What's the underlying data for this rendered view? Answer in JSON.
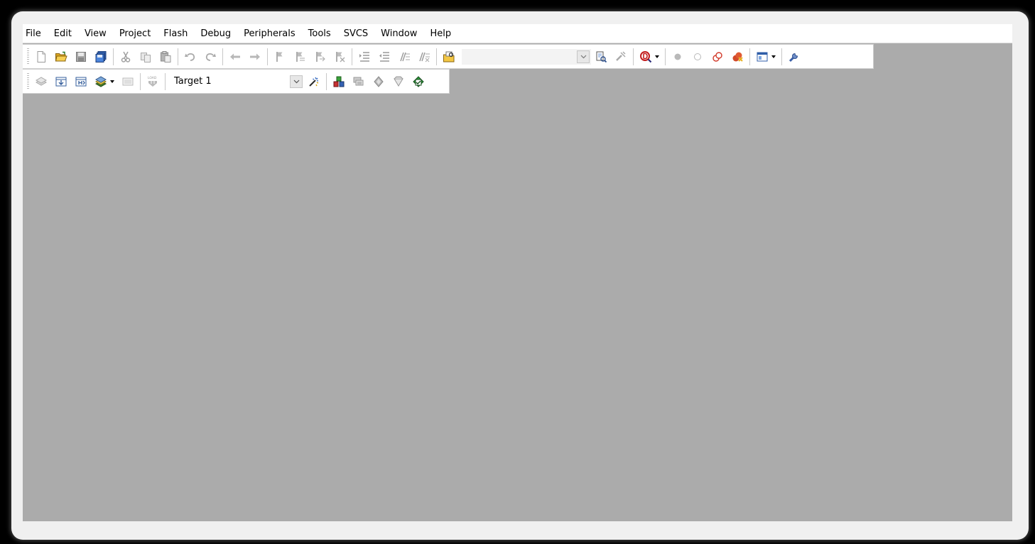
{
  "menu": {
    "items": [
      "File",
      "Edit",
      "View",
      "Project",
      "Flash",
      "Debug",
      "Peripherals",
      "Tools",
      "SVCS",
      "Window",
      "Help"
    ]
  },
  "find_combo": {
    "value": ""
  },
  "target_combo": {
    "value": "Target 1"
  },
  "icons": {
    "file_toolbar": [
      "new-file-icon",
      "open-folder-icon",
      "save-icon",
      "save-all-icon",
      "cut-icon",
      "copy-icon",
      "paste-icon",
      "undo-icon",
      "redo-icon",
      "navigate-back-icon",
      "navigate-forward-icon",
      "bookmark-icon",
      "prev-bookmark-icon",
      "next-bookmark-icon",
      "clear-bookmarks-icon",
      "indent-icon",
      "unindent-icon",
      "comment-icon",
      "uncomment-icon",
      "find-in-files-icon",
      "find-icon",
      "incremental-find-icon",
      "debug-session-icon",
      "breakpoint-icon",
      "disable-breakpoint-icon",
      "disable-all-breakpoints-icon",
      "kill-breakpoints-icon",
      "window-layout-icon",
      "configure-icon"
    ],
    "build_toolbar": [
      "translate-icon",
      "build-icon",
      "rebuild-icon",
      "batch-build-icon",
      "stop-build-icon",
      "download-icon",
      "target-options-icon",
      "manage-components-icon",
      "select-packs-icon",
      "pack-installer-icon",
      "event-recorder-icon",
      "manage-environment-icon"
    ]
  },
  "colors": {
    "client_background": "#ababab",
    "toolbar_background": "#ffffff",
    "frame": "#f0f0f0",
    "outer": "#000000"
  }
}
